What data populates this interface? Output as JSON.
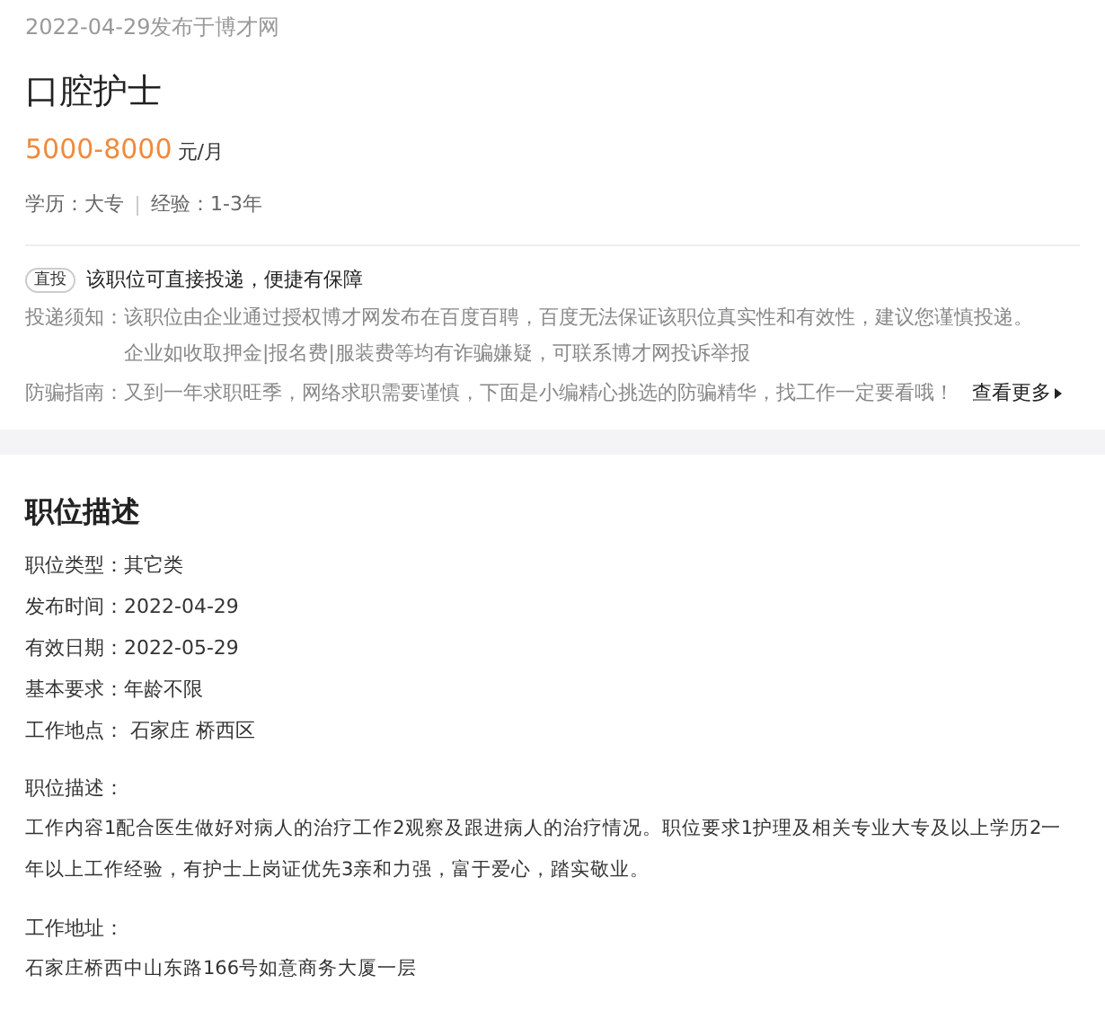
{
  "header": {
    "posted": "2022-04-29发布于博才网",
    "title": "口腔护士",
    "salary": "5000-8000",
    "salary_unit": "元/月",
    "meta": [
      "学历：大专",
      "经验：1-3年"
    ]
  },
  "notice": {
    "badge": "直投",
    "headline": "该职位可直接投递，便捷有保障",
    "rows": [
      {
        "label": "投递须知：",
        "lines": [
          "该职位由企业通过授权博才网发布在百度百聘，百度无法保证该职位真实性和有效性，建议您谨慎投递。",
          "企业如收取押金|报名费|服装费等均有诈骗嫌疑，可联系博才网投诉举报"
        ]
      },
      {
        "label": "防骗指南：",
        "lines": [
          "又到一年求职旺季，网络求职需要谨慎，下面是小编精心挑选的防骗精华，找工作一定要看哦！"
        ],
        "link": "查看更多"
      }
    ]
  },
  "description": {
    "heading": "职位描述",
    "fields": [
      "职位类型：其它类",
      "发布时间：2022-04-29",
      "有效日期：2022-05-29",
      "基本要求：年龄不限",
      "工作地点： 石家庄 桥西区"
    ],
    "sections": [
      {
        "label": "职位描述：",
        "text": "工作内容1配合医生做好对病人的治疗工作2观察及跟进病人的治疗情况。职位要求1护理及相关专业大专及以上学历2一年以上工作经验，有护士上岗证优先3亲和力强，富于爱心，踏实敬业。"
      },
      {
        "label": "工作地址：",
        "text": "石家庄桥西中山东路166号如意商务大厦一层"
      }
    ]
  }
}
